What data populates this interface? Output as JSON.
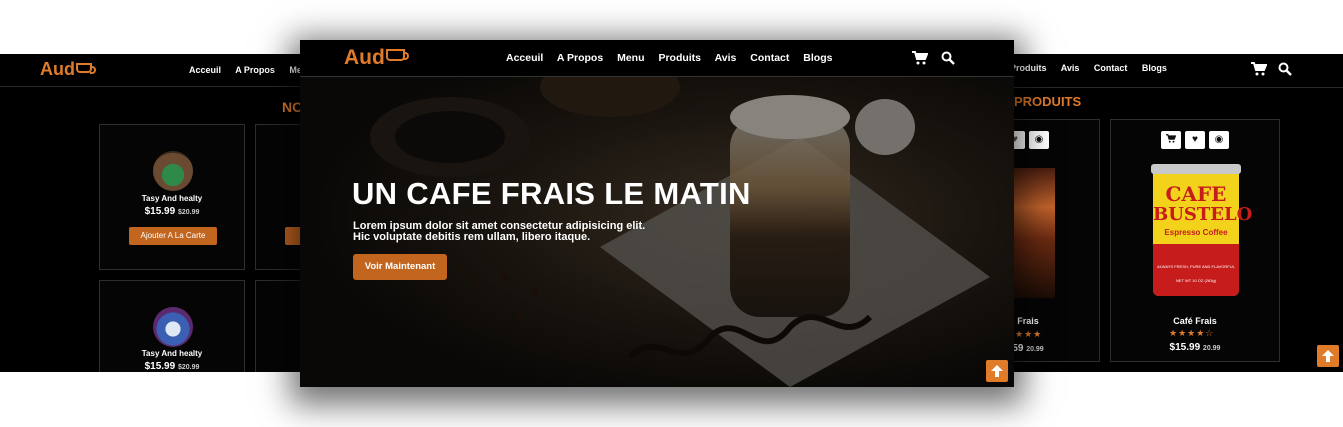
{
  "brand": {
    "logo_text": "Aud",
    "accent_color": "#e07b2a",
    "button_color": "#c2651f"
  },
  "foreground": {
    "nav": {
      "links": [
        "Acceuil",
        "A Propos",
        "Menu",
        "Produits",
        "Avis",
        "Contact",
        "Blogs"
      ],
      "icons": [
        "cart-icon",
        "search-icon"
      ]
    },
    "hero": {
      "title": "UN CAFE FRAIS LE MATIN",
      "text_line1": "Lorem ipsum dolor sit amet consectetur adipisicing elit.",
      "text_line2": "Hic voluptate debitis rem ullam, libero itaque.",
      "cta_label": "Voir Maintenant"
    }
  },
  "left_shot": {
    "nav_links": [
      "Acceuil",
      "A Propos",
      "Me"
    ],
    "section_title": "NO",
    "cards": [
      {
        "name": "Tasy And healty",
        "price": "$15.99",
        "old_price": "$20.99",
        "button": "Ajouter A La Carte"
      },
      {
        "name": "Tasy And healty",
        "price": "$15.99",
        "old_price": "$20.99"
      }
    ]
  },
  "right_shot": {
    "nav_links": [
      "Produits",
      "Avis",
      "Contact",
      "Blogs"
    ],
    "section_title": "PRODUITS",
    "products": [
      {
        "name": "Frais",
        "price": "59",
        "old_price": "20.99",
        "rating": 4
      },
      {
        "name": "Café Frais",
        "price": "$15.99",
        "old_price": "20.99",
        "rating": 4,
        "can_text": {
          "line1": "CAFE",
          "line2": "BUSTELO",
          "line3": "Espresso Coffee",
          "line4": "ALWAYS FRESH, PURE AND FLAVORFUL",
          "line5": "NET WT 10 OZ (283g)"
        }
      }
    ]
  }
}
